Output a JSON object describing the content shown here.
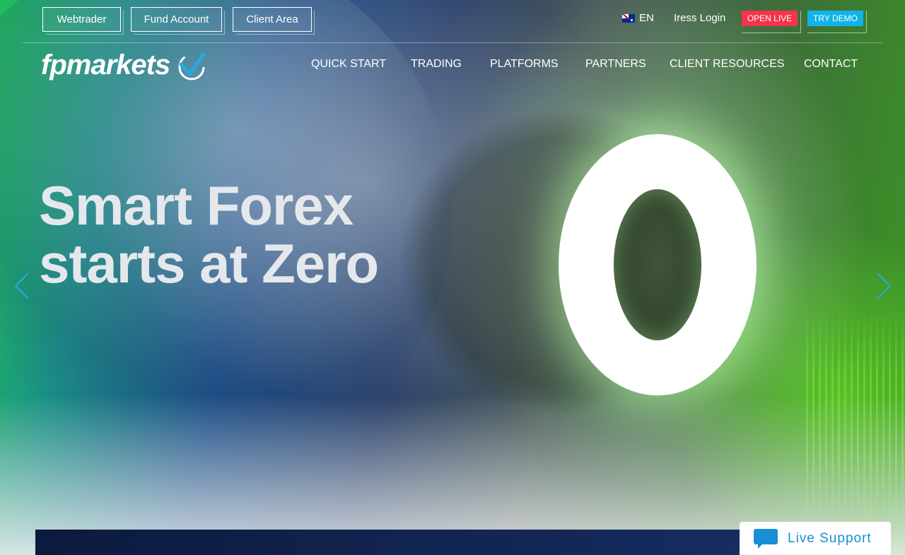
{
  "utility_bar": {
    "webtrader_label": "Webtrader",
    "fund_account_label": "Fund Account",
    "client_area_label": "Client Area",
    "language": "EN",
    "iress_login_label": "Iress Login",
    "open_live_label": "OPEN LIVE",
    "try_demo_label": "TRY DEMO"
  },
  "brand": {
    "logo_text": "fpmarkets"
  },
  "nav": {
    "items": [
      {
        "label": "QUICK START"
      },
      {
        "label": "TRADING"
      },
      {
        "label": "PLATFORMS"
      },
      {
        "label": "PARTNERS"
      },
      {
        "label": "CLIENT RESOURCES"
      },
      {
        "label": "CONTACT"
      }
    ]
  },
  "hero": {
    "headline_line1": "Smart Forex",
    "headline_line2": "starts at Zero",
    "graphic_text": "0"
  },
  "chat": {
    "label": "Live Support"
  },
  "colors": {
    "open_live": "#f2344c",
    "try_demo": "#12b3e8",
    "live_support_text": "#1a8fd6",
    "logo_swoosh": "#29a8e0"
  },
  "icons": {
    "flag": "australia-flag-icon",
    "prev": "chevron-left-icon",
    "next": "chevron-right-icon",
    "chat": "chat-bubble-icon"
  }
}
